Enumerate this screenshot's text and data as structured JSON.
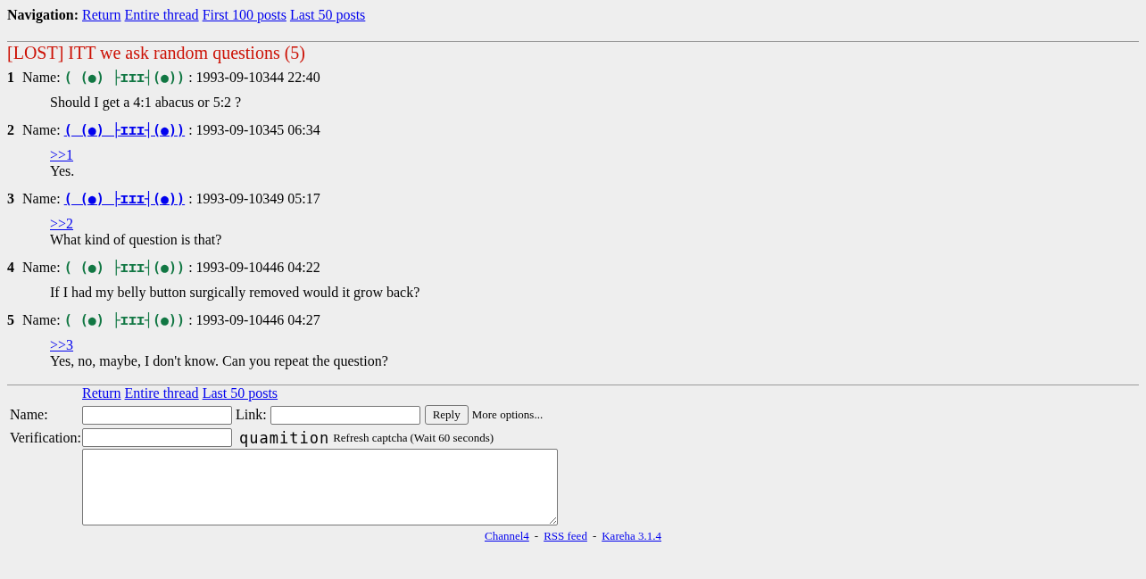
{
  "navigation": {
    "label": "Navigation:",
    "links": [
      "Return",
      "Entire thread",
      "First 100 posts",
      "Last 50 posts"
    ]
  },
  "thread": {
    "title": "[LOST] ITT we ask random questions (5)",
    "posts": [
      {
        "number": "1",
        "name_label": "Name:",
        "name": "( (●) ├ɪɪɪ┤(●))",
        "name_linked": false,
        "date": ": 1993-09-10344 22:40",
        "lines": [
          {
            "kind": "text",
            "text": "Should I get a 4:1 abacus or 5:2 ?"
          }
        ]
      },
      {
        "number": "2",
        "name_label": "Name:",
        "name": "( (●) ├ɪɪɪ┤(●))",
        "name_linked": true,
        "date": ": 1993-09-10345 06:34",
        "lines": [
          {
            "kind": "quote",
            "text": ">>1"
          },
          {
            "kind": "text",
            "text": "Yes."
          }
        ]
      },
      {
        "number": "3",
        "name_label": "Name:",
        "name": "( (●) ├ɪɪɪ┤(●))",
        "name_linked": true,
        "date": ": 1993-09-10349 05:17",
        "lines": [
          {
            "kind": "quote",
            "text": ">>2"
          },
          {
            "kind": "text",
            "text": "What kind of question is that?"
          }
        ]
      },
      {
        "number": "4",
        "name_label": "Name:",
        "name": "( (●) ├ɪɪɪ┤(●))",
        "name_linked": false,
        "date": ": 1993-09-10446 04:22",
        "lines": [
          {
            "kind": "text",
            "text": "If I had my belly button surgically removed would it grow back?"
          }
        ]
      },
      {
        "number": "5",
        "name_label": "Name:",
        "name": "( (●) ├ɪɪɪ┤(●))",
        "name_linked": false,
        "date": ": 1993-09-10446 04:27",
        "lines": [
          {
            "kind": "quote",
            "text": ">>3"
          },
          {
            "kind": "text",
            "text": "Yes, no, maybe, I don't know. Can you repeat the question?"
          }
        ]
      }
    ]
  },
  "reply_form": {
    "links": [
      "Return",
      "Entire thread",
      "Last 50 posts"
    ],
    "name_label": "Name:",
    "link_label": "Link:",
    "reply_button": "Reply",
    "more_options": "More options...",
    "verification_label": "Verification:",
    "captcha": "quamition",
    "refresh_captcha": "Refresh captcha",
    "wait_note": "(Wait 60 seconds)"
  },
  "footer": {
    "links": [
      "Channel4",
      "RSS feed",
      "Kareha 3.1.4"
    ],
    "separator": "-"
  }
}
